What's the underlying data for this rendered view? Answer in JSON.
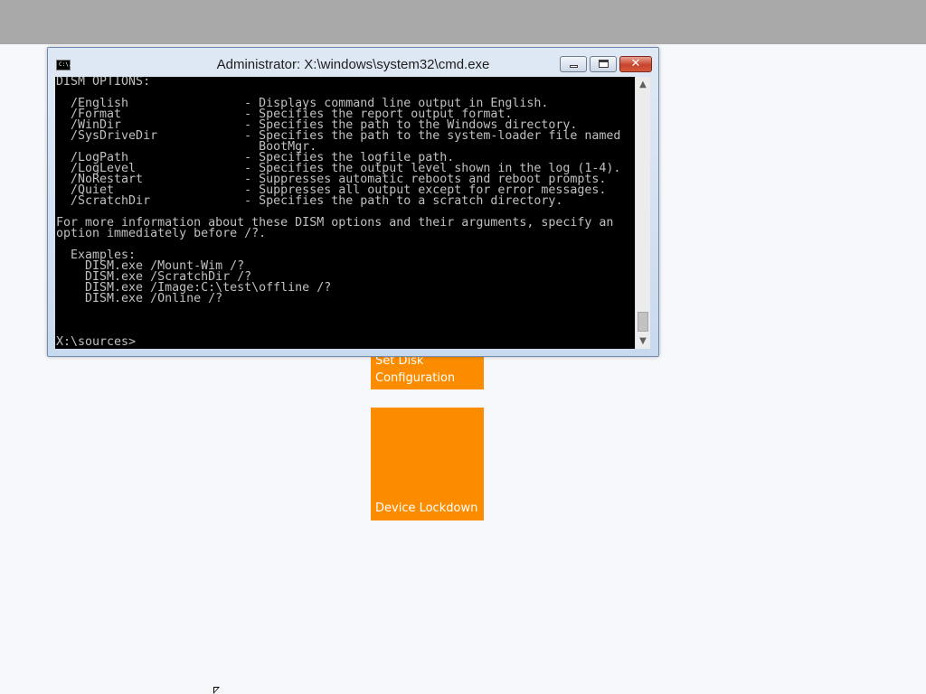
{
  "desktop": {
    "top_bar_color": "#a9a9a9",
    "background_color": "#f7f8fb",
    "tile_color": "#fb8c00",
    "tiles": [
      {
        "label": "Set Disk\nConfiguration"
      },
      {
        "label": "Device Lockdown"
      }
    ]
  },
  "cmd_window": {
    "title": "Administrator: X:\\windows\\system32\\cmd.exe",
    "icon_text": "C:\\.",
    "close_glyph": "✕",
    "scroll_up_glyph": "▲",
    "scroll_down_glyph": "▼",
    "lines": [
      "DISM OPTIONS:",
      "",
      "  /English                - Displays command line output in English.",
      "  /Format                 - Specifies the report output format.",
      "  /WinDir                 - Specifies the path to the Windows directory.",
      "  /SysDriveDir            - Specifies the path to the system-loader file named",
      "                            BootMgr.",
      "  /LogPath                - Specifies the logfile path.",
      "  /LogLevel               - Specifies the output level shown in the log (1-4).",
      "  /NoRestart              - Suppresses automatic reboots and reboot prompts.",
      "  /Quiet                  - Suppresses all output except for error messages.",
      "  /ScratchDir             - Specifies the path to a scratch directory.",
      "",
      "For more information about these DISM options and their arguments, specify an",
      "option immediately before /?.",
      "",
      "  Examples:",
      "    DISM.exe /Mount-Wim /?",
      "    DISM.exe /ScratchDir /?",
      "    DISM.exe /Image:C:\\test\\offline /?",
      "    DISM.exe /Online /?",
      "",
      "",
      "",
      "X:\\sources>"
    ]
  }
}
